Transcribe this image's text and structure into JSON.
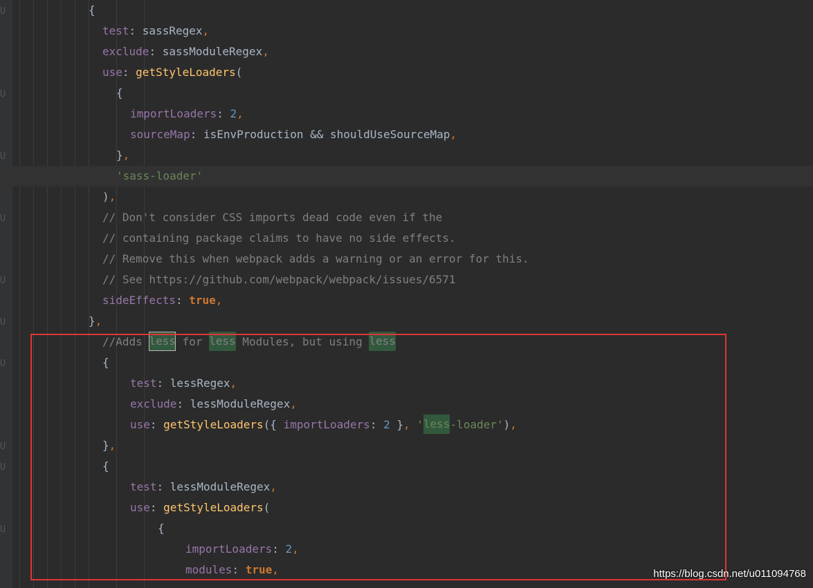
{
  "editor": {
    "lines": [
      {
        "segments": [
          {
            "t": "{",
            "c": "t"
          }
        ]
      },
      {
        "segments": [
          {
            "t": "test",
            "c": "k"
          },
          {
            "t": ": sassRegex",
            "c": "t"
          },
          {
            "t": ",",
            "c": "p"
          }
        ]
      },
      {
        "segments": [
          {
            "t": "exclude",
            "c": "k"
          },
          {
            "t": ": sassModuleRegex",
            "c": "t"
          },
          {
            "t": ",",
            "c": "p"
          }
        ]
      },
      {
        "segments": [
          {
            "t": "use",
            "c": "k"
          },
          {
            "t": ": ",
            "c": "t"
          },
          {
            "t": "getStyleLoaders",
            "c": "f"
          },
          {
            "t": "(",
            "c": "t"
          }
        ]
      },
      {
        "segments": [
          {
            "t": "{",
            "c": "t"
          }
        ]
      },
      {
        "segments": [
          {
            "t": "importLoaders",
            "c": "k"
          },
          {
            "t": ": ",
            "c": "t"
          },
          {
            "t": "2",
            "c": "n"
          },
          {
            "t": ",",
            "c": "p"
          }
        ]
      },
      {
        "segments": [
          {
            "t": "sourceMap",
            "c": "k"
          },
          {
            "t": ": isEnvProduction && shouldUseSourceMap",
            "c": "t"
          },
          {
            "t": ",",
            "c": "p"
          }
        ]
      },
      {
        "segments": [
          {
            "t": "}",
            "c": "t"
          },
          {
            "t": ",",
            "c": "p"
          }
        ]
      },
      {
        "segments": [
          {
            "t": "'sass-loader'",
            "c": "s"
          }
        ],
        "current": true
      },
      {
        "segments": [
          {
            "t": ")",
            "c": "t"
          },
          {
            "t": ",",
            "c": "p"
          }
        ]
      },
      {
        "segments": [
          {
            "t": "// Don't consider CSS imports dead code even if the",
            "c": "c"
          }
        ]
      },
      {
        "segments": [
          {
            "t": "// containing package claims to have no side effects.",
            "c": "c"
          }
        ]
      },
      {
        "segments": [
          {
            "t": "// Remove this when webpack adds a warning or an error for this.",
            "c": "c"
          }
        ]
      },
      {
        "segments": [
          {
            "t": "// See https://github.com/webpack/webpack/issues/6571",
            "c": "c"
          }
        ]
      },
      {
        "segments": [
          {
            "t": "sideEffects",
            "c": "k"
          },
          {
            "t": ": ",
            "c": "t"
          },
          {
            "t": "true",
            "c": "b"
          },
          {
            "t": ",",
            "c": "p"
          }
        ]
      },
      {
        "segments": [
          {
            "t": "}",
            "c": "t"
          },
          {
            "t": ",",
            "c": "p"
          }
        ]
      },
      {
        "segments": [
          {
            "t": "//Adds ",
            "c": "c"
          },
          {
            "t": "less",
            "c": "c",
            "hl": "box"
          },
          {
            "t": " for ",
            "c": "c"
          },
          {
            "t": "less",
            "c": "c",
            "hl": "fill"
          },
          {
            "t": " Modules, but using ",
            "c": "c"
          },
          {
            "t": "less",
            "c": "c",
            "hl": "fill"
          }
        ]
      },
      {
        "segments": [
          {
            "t": "{",
            "c": "t"
          }
        ]
      },
      {
        "segments": [
          {
            "t": "test",
            "c": "k"
          },
          {
            "t": ": lessRegex",
            "c": "t"
          },
          {
            "t": ",",
            "c": "p"
          }
        ]
      },
      {
        "segments": [
          {
            "t": "exclude",
            "c": "k"
          },
          {
            "t": ": lessModuleRegex",
            "c": "t"
          },
          {
            "t": ",",
            "c": "p"
          }
        ]
      },
      {
        "segments": [
          {
            "t": "use",
            "c": "k"
          },
          {
            "t": ": ",
            "c": "t"
          },
          {
            "t": "getStyleLoaders",
            "c": "f"
          },
          {
            "t": "({ ",
            "c": "t"
          },
          {
            "t": "importLoaders",
            "c": "k"
          },
          {
            "t": ": ",
            "c": "t"
          },
          {
            "t": "2",
            "c": "n"
          },
          {
            "t": " }",
            "c": "t"
          },
          {
            "t": ", ",
            "c": "p"
          },
          {
            "t": "'",
            "c": "s"
          },
          {
            "t": "less",
            "c": "s",
            "hl": "fill"
          },
          {
            "t": "-loader'",
            "c": "s"
          },
          {
            "t": ")",
            "c": "t"
          },
          {
            "t": ",",
            "c": "p"
          }
        ]
      },
      {
        "segments": [
          {
            "t": "}",
            "c": "t"
          },
          {
            "t": ",",
            "c": "p"
          }
        ]
      },
      {
        "segments": [
          {
            "t": "{",
            "c": "t"
          }
        ]
      },
      {
        "segments": [
          {
            "t": "test",
            "c": "k"
          },
          {
            "t": ": lessModuleRegex",
            "c": "t"
          },
          {
            "t": ",",
            "c": "p"
          }
        ]
      },
      {
        "segments": [
          {
            "t": "use",
            "c": "k"
          },
          {
            "t": ": ",
            "c": "t"
          },
          {
            "t": "getStyleLoaders",
            "c": "f"
          },
          {
            "t": "(",
            "c": "t"
          }
        ]
      },
      {
        "segments": [
          {
            "t": "{",
            "c": "t"
          }
        ]
      },
      {
        "segments": [
          {
            "t": "importLoaders",
            "c": "k"
          },
          {
            "t": ": ",
            "c": "t"
          },
          {
            "t": "2",
            "c": "n"
          },
          {
            "t": ",",
            "c": "p"
          }
        ]
      },
      {
        "segments": [
          {
            "t": "modules",
            "c": "k"
          },
          {
            "t": ": ",
            "c": "t"
          },
          {
            "t": "true",
            "c": "b"
          },
          {
            "t": ",",
            "c": "p"
          }
        ]
      }
    ]
  },
  "watermark": "https://blog.csdn.net/u011094768",
  "colors": {
    "background": "#2b2b2b",
    "property": "#9876aa",
    "function": "#ffc66d",
    "number": "#6897bb",
    "string": "#6a8759",
    "keyword": "#cc7832",
    "comment": "#808080",
    "identifier": "#a9b7c6",
    "annotation_box": "#e03535"
  }
}
